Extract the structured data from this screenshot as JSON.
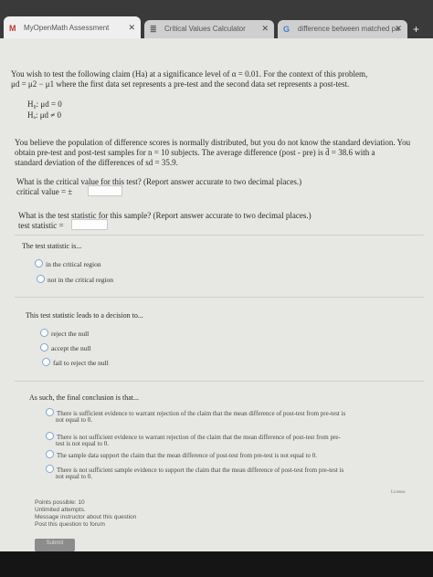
{
  "tabs": [
    {
      "title": "MyOpenMath Assessment",
      "icon": "M"
    },
    {
      "title": "Critical Values Calculator",
      "icon": "≣"
    },
    {
      "title": "difference between matched pa",
      "icon": "G"
    }
  ],
  "question": {
    "intro1": "You wish to test the following claim (Ha) at a significance level of α = 0.01. For the context of this problem,",
    "intro2": "μd = μ2 − μ1 where the first data set represents a pre-test and the second data set represents a post-test.",
    "h0": "H₀: μd = 0",
    "ha": "Hₐ: μd ≠ 0",
    "context1": "You believe the population of difference scores is normally distributed, but you do not know the standard deviation. You",
    "context2": "obtain pre-test and post-test samples for n = 10 subjects. The average difference (post - pre) is d̄ = 38.6 with a",
    "context3": "standard deviation of the differences of sd = 35.9."
  },
  "critical": {
    "prompt": "What is the critical value for this test? (Report answer accurate to two decimal places.)",
    "label": "critical value = ±",
    "value": ""
  },
  "statistic": {
    "prompt": "What is the test statistic for this sample? (Report answer accurate to two decimal places.)",
    "label": "test statistic =",
    "value": ""
  },
  "region": {
    "prompt": "The test statistic is...",
    "options": [
      "in the critical region",
      "not in the critical region"
    ]
  },
  "decision": {
    "prompt": "This test statistic leads to a decision to...",
    "options": [
      "reject the null",
      "accept the null",
      "fail to reject the null"
    ]
  },
  "conclusion": {
    "prompt": "As such, the final conclusion is that...",
    "options": [
      {
        "line1": "There is sufficient evidence to warrant rejection of the claim that the mean difference of post-test from pre-test is",
        "line2": "not equal to 0."
      },
      {
        "line1": "There is not sufficient evidence to warrant rejection of the claim that the mean difference of post-test from pre-",
        "line2": "test is not equal to 0."
      },
      {
        "line1": "The sample data support the claim that the mean difference of post-test from pre-test is not equal to 0.",
        "line2": ""
      },
      {
        "line1": "There is not sufficient sample evidence to support the claim that the mean difference of post-test from pre-test is",
        "line2": "not equal to 0."
      }
    ]
  },
  "license": "License",
  "footer": {
    "points": "Points possible: 10",
    "attempts": "Unlimited attempts.",
    "message": "Message instructor about this question",
    "forum": "Post this question to forum"
  },
  "submit": "Submit"
}
